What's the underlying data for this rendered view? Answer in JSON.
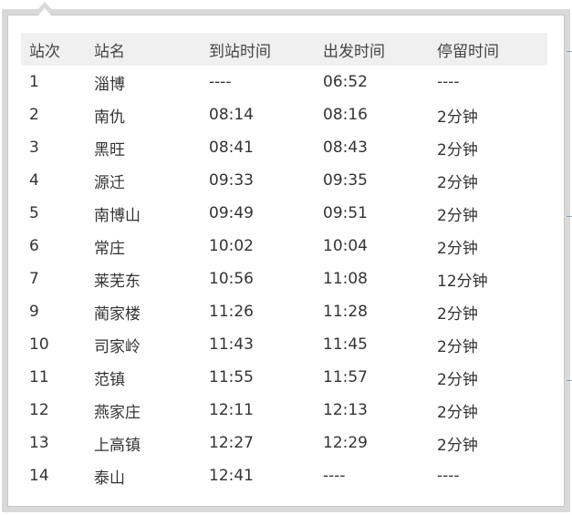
{
  "schedule": {
    "headers": [
      "站次",
      "站名",
      "到站时间",
      "出发时间",
      "停留时间"
    ],
    "rows": [
      [
        "1",
        "淄博",
        "----",
        "06:52",
        "----"
      ],
      [
        "2",
        "南仇",
        "08:14",
        "08:16",
        "2分钟"
      ],
      [
        "3",
        "黑旺",
        "08:41",
        "08:43",
        "2分钟"
      ],
      [
        "4",
        "源迁",
        "09:33",
        "09:35",
        "2分钟"
      ],
      [
        "5",
        "南博山",
        "09:49",
        "09:51",
        "2分钟"
      ],
      [
        "6",
        "常庄",
        "10:02",
        "10:04",
        "2分钟"
      ],
      [
        "7",
        "莱芜东",
        "10:56",
        "11:08",
        "12分钟"
      ],
      [
        "9",
        "蔺家楼",
        "11:26",
        "11:28",
        "2分钟"
      ],
      [
        "10",
        "司家岭",
        "11:43",
        "11:45",
        "2分钟"
      ],
      [
        "11",
        "范镇",
        "11:55",
        "11:57",
        "2分钟"
      ],
      [
        "12",
        "燕家庄",
        "12:11",
        "12:13",
        "2分钟"
      ],
      [
        "13",
        "上高镇",
        "12:27",
        "12:29",
        "2分钟"
      ],
      [
        "14",
        "泰山",
        "12:41",
        "----",
        "----"
      ]
    ]
  },
  "colors": {
    "frame_border": "#d9d9d9",
    "header_bg": "#f0f0f0",
    "text": "#333333"
  }
}
